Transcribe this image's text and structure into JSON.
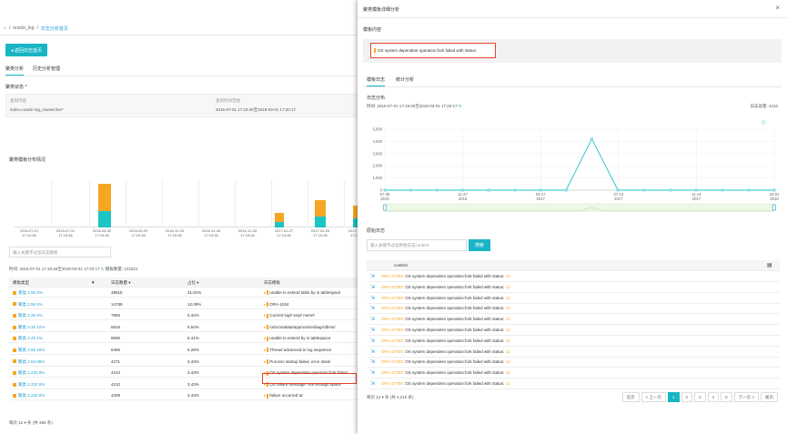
{
  "left": {
    "breadcrumb": [
      "oracle_log",
      "日志分析首页"
    ],
    "back_button": "◂ 返回日志首页",
    "tabs": [
      "聚类分析",
      "历史分析管理"
    ],
    "cluster_state": "聚类状态 ^",
    "info": {
      "label1": "查询内容",
      "value1": "index=oracle log_rowset.line*",
      "label2": "查询时间范围",
      "value2": "2016-07-01 17:19:46至2018-03-01 17:20:17"
    },
    "distribution_title": "聚类模板分布情况",
    "x_labels": [
      [
        "2016-07-01",
        "17:19:46"
      ],
      [
        "2016-07-31",
        "17:19:46"
      ],
      [
        "2016-08-30",
        "17:19:46"
      ],
      [
        "2016-09-29",
        "17:19:46"
      ],
      [
        "2016-10-29",
        "17:19:46"
      ],
      [
        "2016-11-28",
        "17:19:46"
      ],
      [
        "2016-12-28",
        "17:19:46"
      ],
      [
        "2017-01-27",
        "17:19:46"
      ],
      [
        "2017-02-26",
        "17:19:46"
      ],
      [
        "2017-03",
        "17:19"
      ]
    ],
    "search_placeholder": "输入关键字过滤日志模板",
    "time_text": "时间: 2016-07-01 17:19:46至2018-03-01 17:20:17",
    "total_text": "模板数量: 122221",
    "table_headers": [
      "模板类型",
      "日志数量 ▾",
      "占比 ▾",
      "日志模板"
    ],
    "rows": [
      {
        "type": "重复 2.56 3%",
        "count": "38818",
        "pct": "31.81%",
        "tpl": "unable to extend table  by  in  tablespace"
      },
      {
        "type": "聚类 2.58 4%",
        "count": "14789",
        "pct": "12.09%",
        "tpl": "ORA-1534"
      },
      {
        "type": "聚类 2.25 5%",
        "count": "7865",
        "pct": "6.42%",
        "tpl": "Current log#  seq#  mem#"
      },
      {
        "type": "聚类 2.25 12%",
        "count": "6816",
        "pct": "5.54%",
        "tpl": "/u01/oradata/app/oracle/diag/rdbms/"
      },
      {
        "type": "聚类 2.25 1%",
        "count": "6606",
        "pct": "5.41%",
        "tpl": "unable to extend  by  in  tablespace"
      },
      {
        "type": "聚类 2.56 16%",
        "count": "6466",
        "pct": "5.29%",
        "tpl": "Thread  advanced to log sequence"
      },
      {
        "type": "聚类 2.53 86%",
        "count": "4271",
        "pct": "3.43%",
        "tpl": "Process startup failed, error stack"
      },
      {
        "type": "聚类 2.232 8%",
        "count": "4210",
        "pct": "3.43%",
        "tpl": "OS system dependent operation:fork failed"
      },
      {
        "type": "聚类 2.232 8%",
        "count": "4210",
        "pct": "3.43%",
        "tpl": "OS failure message: Not enough space"
      },
      {
        "type": "聚类 2.232 8%",
        "count": "4209",
        "pct": "3.43%",
        "tpl": "failure occurred at:"
      }
    ],
    "footer": "每页 12 ▾ 条   (共 385 条)"
  },
  "panel": {
    "title": "聚类模板详细分析",
    "close": "×",
    "template_label": "模板内容",
    "template_text": "OS system dependent operation:fork failed with status:",
    "tabs": [
      "模板日志",
      "统计分析"
    ],
    "dist_label": "日志分布",
    "time_text": "时间: 2016-07-01 17:19:46至2018-03-01 17:20:17",
    "count_text": "日志总量: 4210",
    "raw_label": "原始日志",
    "search_placeholder": "输入关键字过滤原始日志content",
    "search_button": "搜索",
    "table_header": "content",
    "raw_rows": [
      {
        "code": "ORA-27300:",
        "text": "OS system dependent operation:fork failed with status:",
        "num": "12"
      },
      {
        "code": "ORA-27300:",
        "text": "OS system dependent operation:fork failed with status:",
        "num": "12"
      },
      {
        "code": "ORA-27300:",
        "text": "OS system dependent operation:fork failed with status:",
        "num": "12"
      },
      {
        "code": "ORA-27300:",
        "text": "OS system dependent operation:fork failed with status:",
        "num": "12"
      },
      {
        "code": "ORA-27300:",
        "text": "OS system dependent operation:fork failed with status:",
        "num": "12"
      },
      {
        "code": "ORA-27300:",
        "text": "OS system dependent operation:fork failed with status:",
        "num": "12"
      },
      {
        "code": "ORA-27300:",
        "text": "OS system dependent operation:fork failed with status:",
        "num": "12"
      },
      {
        "code": "ORA-27300:",
        "text": "OS system dependent operation:fork failed with status:",
        "num": "12"
      },
      {
        "code": "ORA-27300:",
        "text": "OS system dependent operation:fork failed with status:",
        "num": "12"
      },
      {
        "code": "ORA-27300:",
        "text": "OS system dependent operation:fork failed with status:",
        "num": "12"
      },
      {
        "code": "ORA-27300:",
        "text": "OS system dependent operation:fork failed with status:",
        "num": "12"
      }
    ],
    "footer_prefix": "每页",
    "footer_size": "12 ▾",
    "footer_suffix": "条   (共 4,210 条)",
    "pager": [
      "首页",
      "< 上一页",
      "1",
      "2",
      "3",
      "4",
      "5",
      "下一页 >",
      "尾页"
    ]
  },
  "chart_data": {
    "type": "line",
    "y_ticks": [
      "5,000",
      "4,000",
      "3,000",
      "2,000",
      "1,000",
      "0"
    ],
    "ylim": [
      0,
      5000
    ],
    "x_tick_labels": [
      [
        "07-30",
        "2016"
      ],
      [
        "11-27",
        "2016"
      ],
      [
        "03-17",
        "2017"
      ],
      [
        "07-13",
        "2017"
      ],
      [
        "11-14",
        "2017"
      ],
      [
        "03-01",
        "2018"
      ]
    ],
    "x": [
      "2016-07-01",
      "2016-08-10",
      "2016-09-20",
      "2016-10-30",
      "2016-12-10",
      "2017-01-20",
      "2017-03-01",
      "2017-04-10",
      "2017-05-20",
      "2017-06-30",
      "2017-08-10",
      "2017-09-20",
      "2017-10-30",
      "2017-12-10",
      "2018-01-20",
      "2018-03-01"
    ],
    "values": [
      0,
      0,
      0,
      0,
      0,
      0,
      0,
      0,
      4210,
      0,
      0,
      0,
      0,
      0,
      0,
      0
    ],
    "color": "#1cc4c4"
  }
}
